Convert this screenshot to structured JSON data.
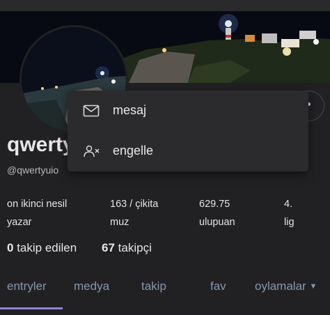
{
  "profile": {
    "username": "qwerty",
    "handle": "@qwertyuio"
  },
  "menu": {
    "items": [
      {
        "label": "mesaj",
        "icon": "envelope-icon"
      },
      {
        "label": "engelle",
        "icon": "block-user-icon"
      }
    ]
  },
  "stats": [
    {
      "line1": "on ikinci nesil",
      "line2": "yazar"
    },
    {
      "line1": "163 / çikita",
      "line2": "muz"
    },
    {
      "line1": "629.75",
      "line2": "ulupuan"
    },
    {
      "line1": "4.",
      "line2": "lig"
    }
  ],
  "follow": {
    "following_count": "0",
    "following_label": "takip edilen",
    "followers_count": "67",
    "followers_label": "takipçi"
  },
  "tabs": [
    {
      "label": "entryler",
      "active": true
    },
    {
      "label": "medya",
      "active": false
    },
    {
      "label": "takip",
      "active": false
    },
    {
      "label": "fav",
      "active": false
    },
    {
      "label": "oylamalar",
      "active": false
    }
  ],
  "colors": {
    "accent": "#8c83d8",
    "tab_text": "#8797aa",
    "background": "#212124",
    "dropdown_bg": "#2b2b2e"
  }
}
